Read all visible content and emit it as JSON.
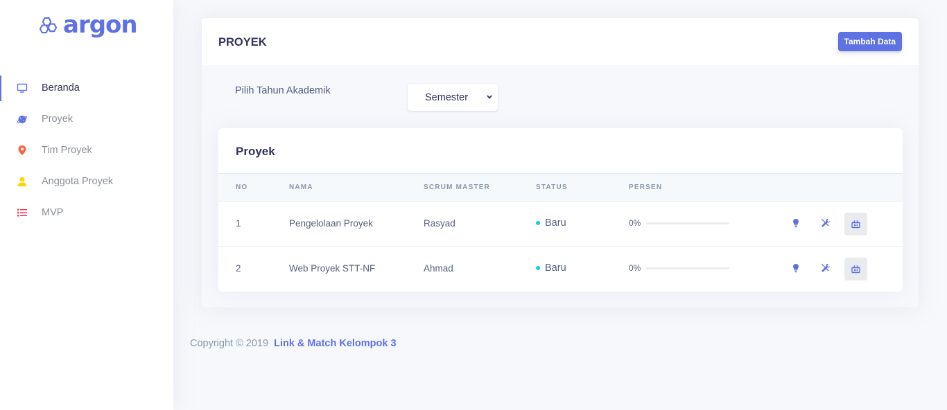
{
  "brand": {
    "name": "argon"
  },
  "sidebar": {
    "items": [
      {
        "label": "Beranda",
        "icon": "monitor-icon",
        "color": "#5e72e4",
        "active": true
      },
      {
        "label": "Proyek",
        "icon": "planet-icon",
        "color": "#5e72e4",
        "active": false
      },
      {
        "label": "Tim Proyek",
        "icon": "pin-icon",
        "color": "#fb6340",
        "active": false
      },
      {
        "label": "Anggota Proyek",
        "icon": "user-icon",
        "color": "#ffd600",
        "active": false
      },
      {
        "label": "MVP",
        "icon": "list-icon",
        "color": "#f5365c",
        "active": false
      }
    ]
  },
  "page": {
    "title": "PROYEK",
    "add_button": "Tambah Data",
    "filter_label": "Pilih Tahun Akademik",
    "select_value": "Semester"
  },
  "table": {
    "title": "Proyek",
    "headers": [
      "NO",
      "NAMA",
      "SCRUM MASTER",
      "STATUS",
      "PERSEN"
    ],
    "rows": [
      {
        "no": "1",
        "nama": "Pengelolaan Proyek",
        "scrum_master": "Rasyad",
        "status": "Baru",
        "persen": "0%",
        "progress": 0
      },
      {
        "no": "2",
        "nama": "Web Proyek STT-NF",
        "scrum_master": "Ahmad",
        "status": "Baru",
        "persen": "0%",
        "progress": 0
      }
    ]
  },
  "footer": {
    "copyright": "Copyright © 2019",
    "link": "Link & Match Kelompok 3"
  },
  "colors": {
    "primary": "#5e72e4",
    "info": "#11cdef",
    "warning": "#fb6340",
    "yellow": "#ffd600",
    "danger": "#f5365c"
  }
}
